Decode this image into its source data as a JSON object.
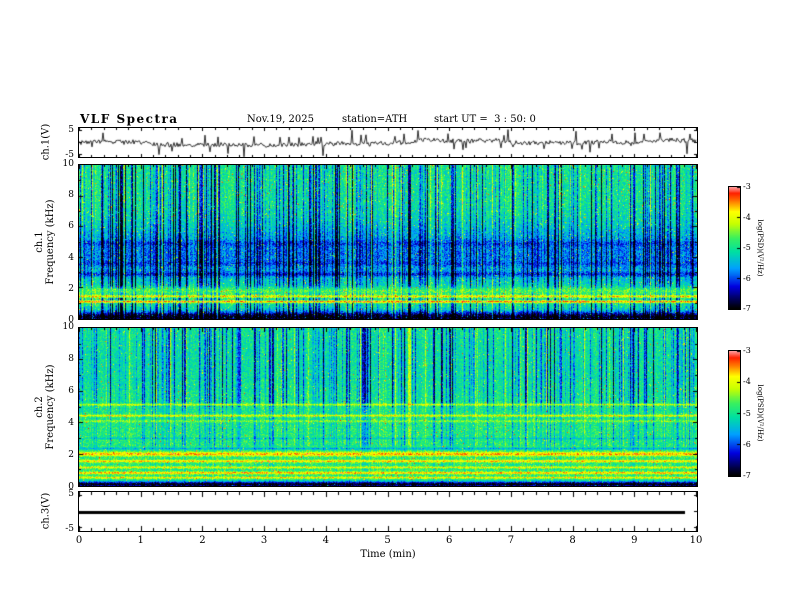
{
  "header": {
    "title": "VLF Spectra",
    "date": "Nov.19, 2025",
    "station": "station=ATH",
    "start_ut": "start UT =  3 : 50: 0"
  },
  "time_axis": {
    "label": "Time (min)",
    "ticks": [
      "0",
      "1",
      "2",
      "3",
      "4",
      "5",
      "6",
      "7",
      "8",
      "9",
      "10"
    ],
    "range_min": [
      0,
      10
    ]
  },
  "panels": {
    "ch1_wave": {
      "ylabel": "ch.1(V)",
      "yticks": [
        "5",
        "-5"
      ],
      "ytick_values": [
        5,
        -5
      ]
    },
    "ch1_spec": {
      "ylabel_outer": "ch.1",
      "ylabel_inner": "Frequency (kHz)",
      "yticks": [
        "10",
        "8",
        "6",
        "4",
        "2",
        "0"
      ],
      "ytick_values": [
        10,
        8,
        6,
        4,
        2,
        0
      ]
    },
    "ch2_spec": {
      "ylabel_outer": "ch.2",
      "ylabel_inner": "Frequency (kHz)",
      "yticks": [
        "10",
        "8",
        "6",
        "4",
        "2",
        "0"
      ],
      "ytick_values": [
        10,
        8,
        6,
        4,
        2,
        0
      ]
    },
    "ch3_wave": {
      "ylabel": "ch.3(V)",
      "yticks": [
        "5",
        "-5"
      ],
      "ytick_values": [
        5,
        -5
      ]
    }
  },
  "colorbar": {
    "label": "log(PSD)(V²/Hz)",
    "ticks": [
      "-3",
      "-4",
      "-5",
      "-6",
      "-7"
    ],
    "tick_values": [
      -3,
      -4,
      -5,
      -6,
      -7
    ],
    "range": [
      -7,
      -3
    ]
  },
  "colors": {
    "background": "#ffffff",
    "frame": "#000000",
    "trace": "#000000",
    "colormap_stops": [
      {
        "t": 0.0,
        "hex": "#000000"
      },
      {
        "t": 0.07,
        "hex": "#000050"
      },
      {
        "t": 0.18,
        "hex": "#0000e0"
      },
      {
        "t": 0.33,
        "hex": "#00a0ff"
      },
      {
        "t": 0.47,
        "hex": "#00e0a0"
      },
      {
        "t": 0.58,
        "hex": "#38f060"
      },
      {
        "t": 0.7,
        "hex": "#c8ff00"
      },
      {
        "t": 0.8,
        "hex": "#ffff00"
      },
      {
        "t": 0.88,
        "hex": "#ff8000"
      },
      {
        "t": 0.95,
        "hex": "#ff2000"
      },
      {
        "t": 1.0,
        "hex": "#ff9898"
      }
    ]
  },
  "chart_data": [
    {
      "type": "line",
      "name": "ch1_waveform",
      "ylabel": "ch.1(V)",
      "xlim": [
        0,
        10
      ],
      "ylim": [
        -6,
        6
      ],
      "ytick_values": [
        5,
        -5
      ],
      "description": "broadband noise waveform ~±1 V with dense bipolar impulsive spikes reaching ±5 V",
      "noise_amplitude_v": 0.9,
      "spike_probability": 0.09,
      "spike_min_v": 2.0,
      "spike_max_v": 4.8,
      "seed": 42
    },
    {
      "type": "heatmap",
      "name": "ch1_spectrogram",
      "ylabel": "ch.1 Frequency (kHz)",
      "xlim": [
        0,
        10
      ],
      "ylim": [
        0,
        10
      ],
      "value_label": "log(PSD)(V²/Hz)",
      "value_range": [
        -7,
        -3
      ],
      "base_level": -5.0,
      "speckle": 0.9,
      "bright_speckle_prob": 0.02,
      "bands": [
        {
          "f_khz": 4.2,
          "sigma_khz": 1.35,
          "level": -5.8,
          "note": "broad low-PSD blue region 2.5-6 kHz with dense dark vertical streaks"
        },
        {
          "f_khz": 0.1,
          "sigma_khz": 0.25,
          "level": -7.0,
          "note": "near-black band along bottom edge"
        },
        {
          "f_khz": 1.1,
          "sigma_khz": 0.06,
          "level": -3.4,
          "note": "bright red narrowband line"
        },
        {
          "f_khz": 1.45,
          "sigma_khz": 0.07,
          "level": -3.6,
          "note": "bright orange narrowband line"
        },
        {
          "f_khz": 1.8,
          "sigma_khz": 0.18,
          "level": -4.6,
          "note": "yellow-green band"
        },
        {
          "f_khz": 2.9,
          "sigma_khz": 0.1,
          "level": -6.15,
          "note": "dark blue line"
        },
        {
          "f_khz": 3.6,
          "sigma_khz": 0.1,
          "level": -6.05,
          "note": "dark blue line"
        },
        {
          "f_khz": 4.9,
          "sigma_khz": 0.12,
          "level": -6.05,
          "note": "dark blue line"
        }
      ],
      "streaks": {
        "neg_prob": 0.17,
        "soft_prob": 0.14,
        "pos_prob": 0.05,
        "neg_min": 0.8,
        "neg_max": 2.0,
        "low_gain": 1,
        "mid_gain": 1,
        "high_gain": 1,
        "mid_above_khz": 0,
        "high_above_khz": 0
      },
      "special_columns": [
        {
          "t_min": 5.35,
          "delta": -1.6
        },
        {
          "t_min": 6.05,
          "delta": -1.2
        }
      ],
      "seed": 1337
    },
    {
      "type": "heatmap",
      "name": "ch2_spectrogram",
      "ylabel": "ch.2 Frequency (kHz)",
      "xlim": [
        0,
        10
      ],
      "ylim": [
        0,
        10
      ],
      "value_label": "log(PSD)(V²/Hz)",
      "value_range": [
        -7,
        -3
      ],
      "base_level": -4.85,
      "speckle": 0.8,
      "bright_speckle_prob": 0.012,
      "bands": [
        {
          "f_khz": 8.0,
          "sigma_khz": 2.2,
          "level": -5.1,
          "note": "slightly lower PSD cyan region above 6 kHz with blue streaks"
        },
        {
          "f_khz": 0.08,
          "sigma_khz": 0.12,
          "level": -7.0,
          "note": "black line at bottom edge"
        },
        {
          "f_khz": 0.5,
          "sigma_khz": 0.05,
          "level": -3.8,
          "note": "bright line"
        },
        {
          "f_khz": 0.8,
          "sigma_khz": 0.06,
          "level": -3.6,
          "note": "bright line"
        },
        {
          "f_khz": 1.15,
          "sigma_khz": 0.05,
          "level": -3.9,
          "note": "bright line"
        },
        {
          "f_khz": 1.55,
          "sigma_khz": 0.06,
          "level": -3.7,
          "note": "orange line"
        },
        {
          "f_khz": 2.0,
          "sigma_khz": 0.1,
          "level": -3.6,
          "note": "brightest yellow band"
        },
        {
          "f_khz": 2.35,
          "sigma_khz": 0.05,
          "level": -5.5,
          "note": "dark line"
        },
        {
          "f_khz": 3.0,
          "sigma_khz": 0.04,
          "level": -5.3,
          "note": "faint dark line"
        },
        {
          "f_khz": 4.1,
          "sigma_khz": 0.05,
          "level": -4.4,
          "note": "yellow-green line"
        },
        {
          "f_khz": 4.45,
          "sigma_khz": 0.05,
          "level": -3.9,
          "note": "yellow line"
        },
        {
          "f_khz": 5.15,
          "sigma_khz": 0.05,
          "level": -4.1,
          "note": "yellow line"
        },
        {
          "f_khz": 6.8,
          "sigma_khz": 0.04,
          "level": -5.2,
          "note": "faint dark line"
        }
      ],
      "streaks": {
        "neg_prob": 0.15,
        "soft_prob": 0.15,
        "pos_prob": 0.04,
        "neg_min": 0.7,
        "neg_max": 1.8,
        "low_gain": 0.25,
        "mid_gain": 0.55,
        "high_gain": 1.0,
        "mid_above_khz": 2.5,
        "high_above_khz": 5.0
      },
      "special_columns": [
        {
          "t_min": 5.35,
          "delta": 0.9
        },
        {
          "t_min": 2.6,
          "delta": -1.0
        }
      ],
      "seed": 2024
    },
    {
      "type": "line",
      "name": "ch3_waveform",
      "ylabel": "ch.3(V)",
      "xlim": [
        0,
        10
      ],
      "ylim": [
        -6,
        6
      ],
      "ytick_values": [
        5,
        -5
      ],
      "description": "constant 0 V flat thick trace ending near 9.8 min (channel idle)",
      "value_v": 0,
      "line_end_min": 9.8,
      "line_thickness_px": 3,
      "seed": 7
    }
  ]
}
